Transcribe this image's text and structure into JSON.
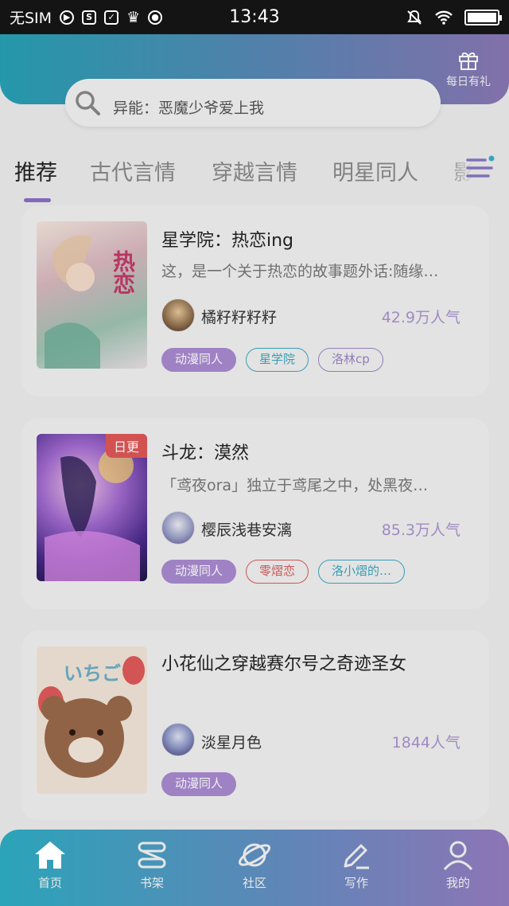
{
  "status_bar": {
    "carrier": "无SIM",
    "time": "13:43",
    "icons": [
      "play-icon",
      "s-app-icon",
      "check-icon",
      "crown-icon",
      "camera-icon",
      "mute-icon",
      "wifi-icon",
      "battery-icon"
    ]
  },
  "header": {
    "gift_label": "每日有礼",
    "search_placeholder": "异能：恶魔少爷爱上我"
  },
  "tabs": [
    "推荐",
    "古代言情",
    "穿越言情",
    "明星同人",
    "影视"
  ],
  "active_tab_index": 0,
  "books": [
    {
      "title": "星学院：热恋ing",
      "description": "这，是一个关于热恋的故事题外话:随缘…",
      "author": "橘籽籽籽籽",
      "popularity": "42.9万人气",
      "badge": "",
      "cover_text": "热恋",
      "tags": [
        {
          "label": "动漫同人",
          "style": "purple"
        },
        {
          "label": "星学院",
          "style": "blue"
        },
        {
          "label": "洛林cp",
          "style": "violet"
        }
      ]
    },
    {
      "title": "斗龙：漠然",
      "description": "「鸢夜ora」独立于鸢尾之中，处黑夜…",
      "author": "樱辰浅巷安漓",
      "popularity": "85.3万人气",
      "badge": "日更",
      "cover_text": "",
      "tags": [
        {
          "label": "动漫同人",
          "style": "purple"
        },
        {
          "label": "零熠恋",
          "style": "red"
        },
        {
          "label": "洛小熠的…",
          "style": "blue"
        }
      ]
    },
    {
      "title": "小花仙之穿越赛尔号之奇迹圣女",
      "description": "",
      "author": "淡星月色",
      "popularity": "1844人气",
      "badge": "",
      "cover_text": "いちご",
      "tags": [
        {
          "label": "动漫同人",
          "style": "purple"
        }
      ]
    }
  ],
  "bottom_nav": [
    {
      "label": "首页",
      "icon": "home-icon"
    },
    {
      "label": "书架",
      "icon": "bookshelf-icon"
    },
    {
      "label": "社区",
      "icon": "planet-icon"
    },
    {
      "label": "写作",
      "icon": "pen-icon"
    },
    {
      "label": "我的",
      "icon": "profile-icon"
    }
  ],
  "colors": {
    "accent": "#8b6fc4",
    "gradient_start": "#27a2b5",
    "gradient_end": "#8a78b5",
    "popularity": "#a894cf"
  }
}
